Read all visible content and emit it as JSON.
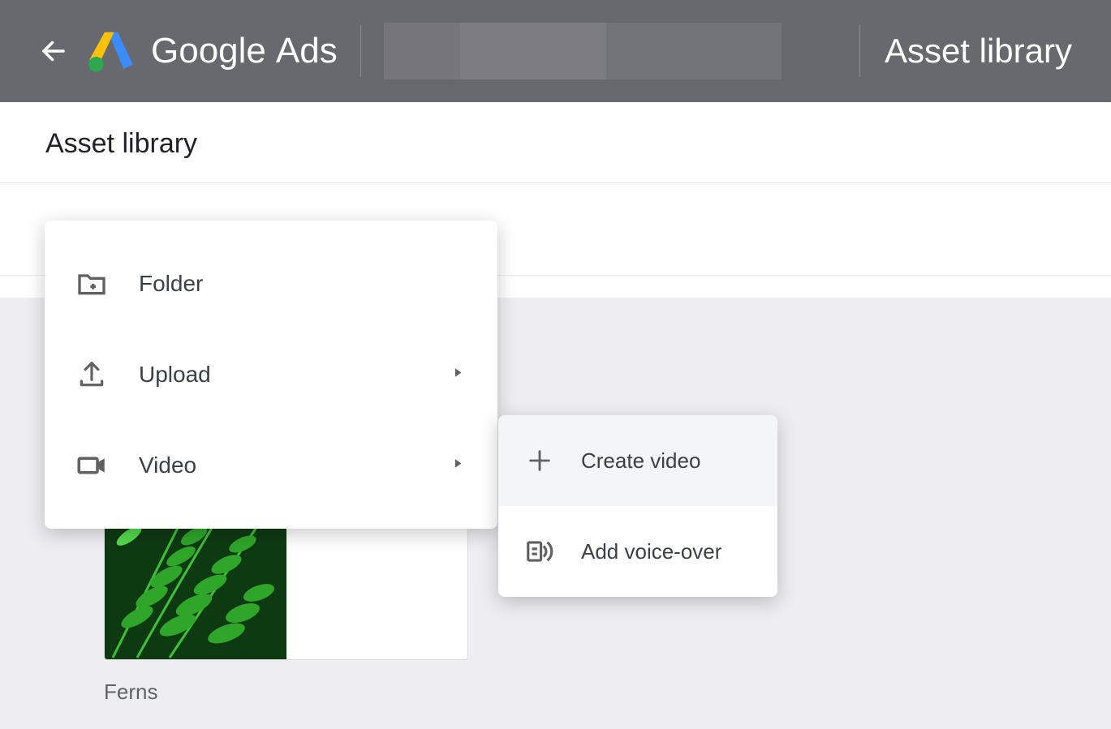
{
  "header": {
    "brand_google": "Google",
    "brand_ads": "Ads",
    "title": "Asset library"
  },
  "page": {
    "title": "Asset library"
  },
  "menu": {
    "items": [
      {
        "label": "Folder",
        "has_submenu": false
      },
      {
        "label": "Upload",
        "has_submenu": true
      },
      {
        "label": "Video",
        "has_submenu": true
      }
    ]
  },
  "submenu": {
    "items": [
      {
        "label": "Create video"
      },
      {
        "label": "Add voice-over"
      }
    ]
  },
  "asset": {
    "label": "Ferns"
  }
}
